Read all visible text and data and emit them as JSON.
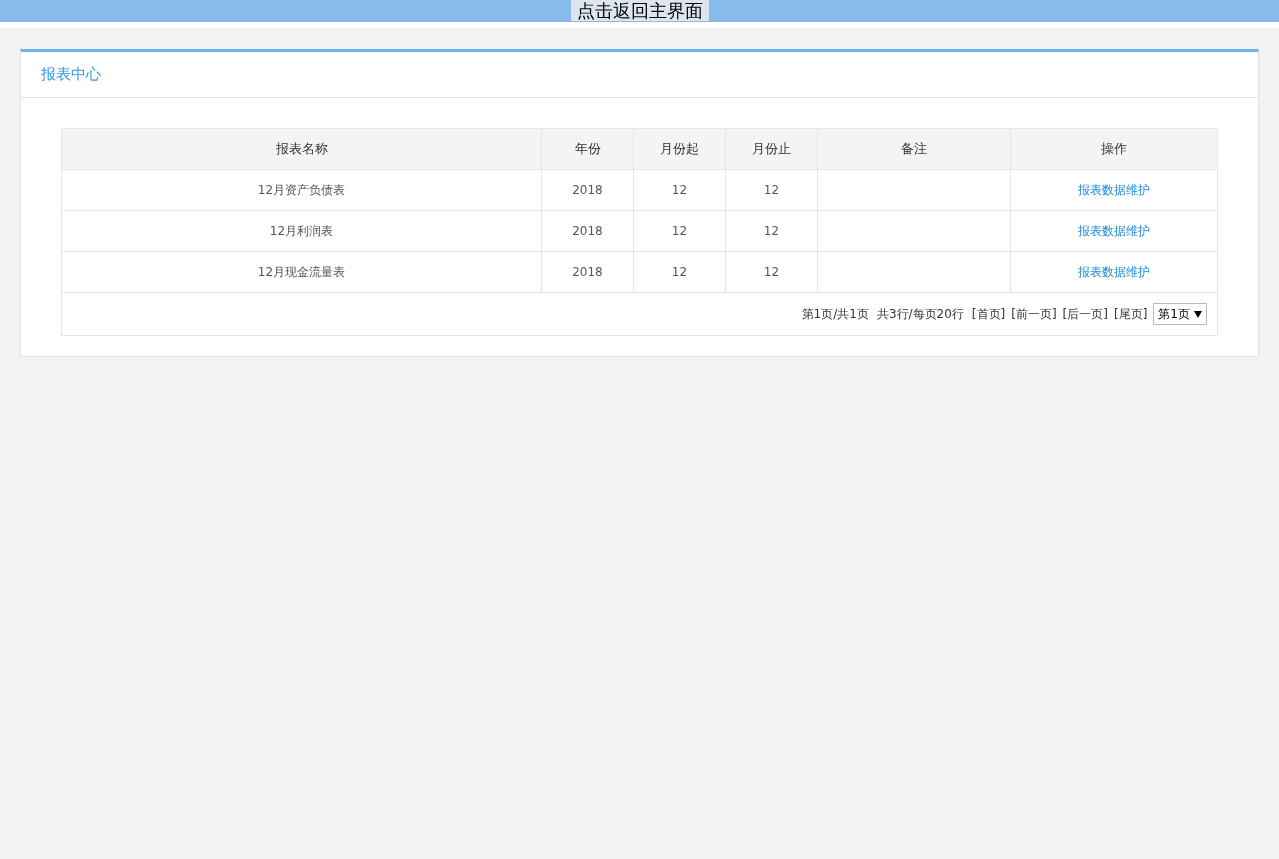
{
  "top_bar": {
    "back_button": "点击返回主界面"
  },
  "panel": {
    "title": "报表中心"
  },
  "table": {
    "columns": [
      "报表名称",
      "年份",
      "月份起",
      "月份止",
      "备注",
      "操作"
    ],
    "rows": [
      {
        "name": "12月资产负债表",
        "year": "2018",
        "month_from": "12",
        "month_to": "12",
        "action": "报表数据维护"
      },
      {
        "name": "12月利润表",
        "year": "2018",
        "month_from": "12",
        "month_to": "12",
        "action": "报表数据维护"
      },
      {
        "name": "12月现金流量表",
        "year": "2018",
        "month_from": "12",
        "month_to": "12",
        "action": "报表数据维护"
      }
    ]
  },
  "pager": {
    "page_info": "第1页/共1页",
    "row_info": "共3行/每页20行",
    "links": [
      "[首页]",
      "[前一页]",
      "[后一页]",
      "[尾页]"
    ],
    "page_select": "第1页"
  }
}
